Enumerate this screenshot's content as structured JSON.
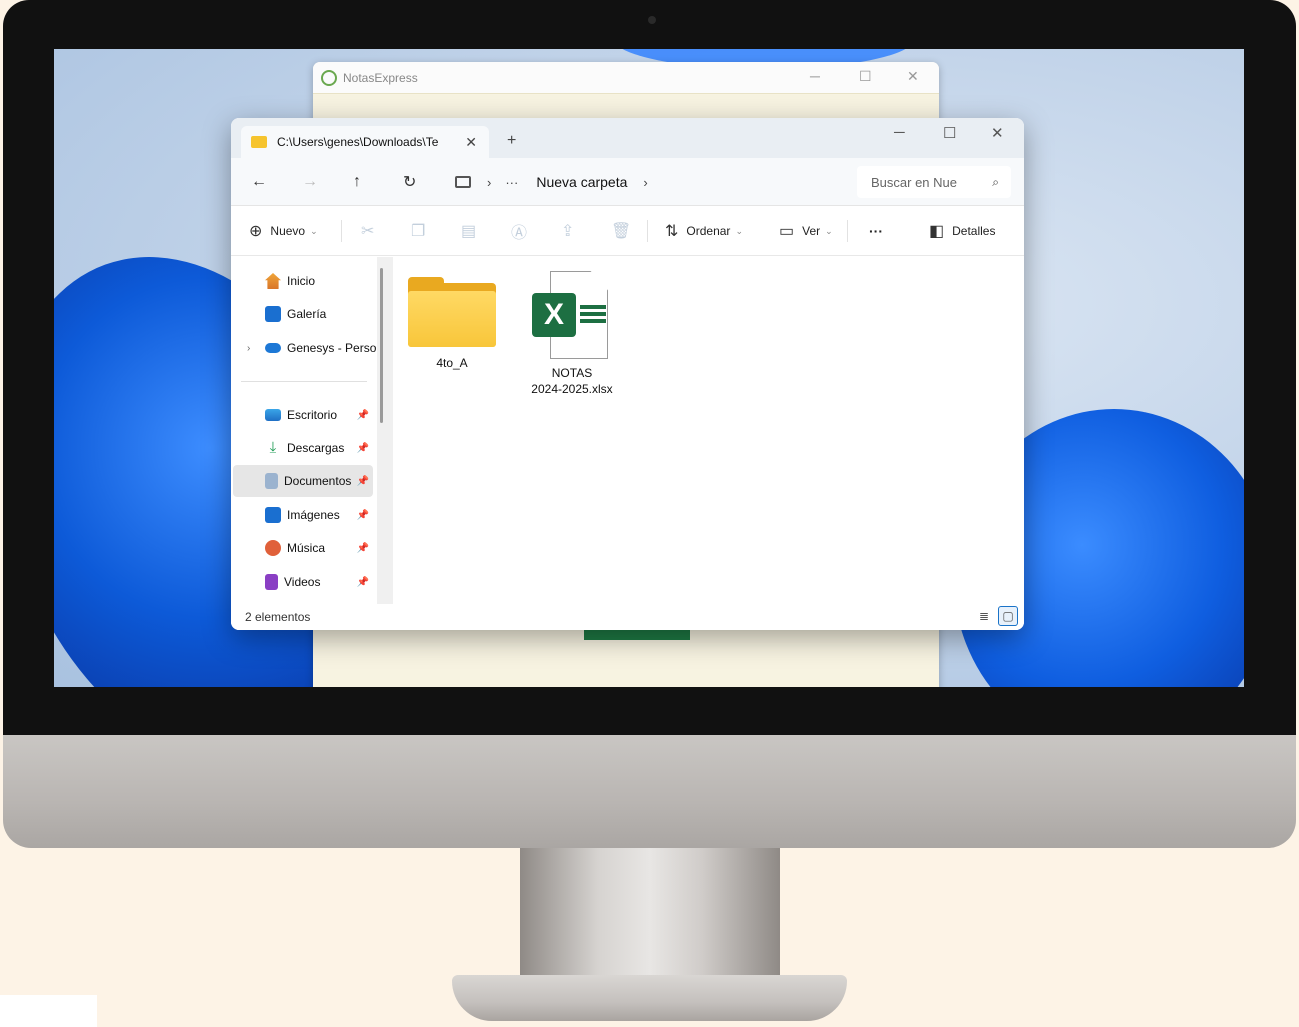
{
  "notas_window": {
    "title": "NotasExpress"
  },
  "explorer": {
    "tab_title": "C:\\Users\\genes\\Downloads\\Te",
    "new_tab": "+",
    "breadcrumb": {
      "dots": "···",
      "current": "Nueva carpeta"
    },
    "search": {
      "placeholder": "Buscar en Nue"
    },
    "toolbar": {
      "new_label": "Nuevo",
      "sort_label": "Ordenar",
      "view_label": "Ver",
      "more_label": "···",
      "details_label": "Detalles"
    },
    "sidebar": {
      "items": [
        {
          "label": "Inicio",
          "icon": "home-icon"
        },
        {
          "label": "Galería",
          "icon": "gallery-icon"
        },
        {
          "label": "Genesys - Persor",
          "icon": "onedrive-icon"
        },
        {
          "label": "Escritorio",
          "icon": "desktop-icon"
        },
        {
          "label": "Descargas",
          "icon": "downloads-icon"
        },
        {
          "label": "Documentos",
          "icon": "documents-icon",
          "selected": true
        },
        {
          "label": "Imágenes",
          "icon": "pictures-icon"
        },
        {
          "label": "Música",
          "icon": "music-icon"
        },
        {
          "label": "Videos",
          "icon": "videos-icon"
        }
      ]
    },
    "files": [
      {
        "name": "4to_A",
        "type": "folder"
      },
      {
        "name_line1": "NOTAS",
        "name_line2": "2024-2025.xlsx",
        "type": "excel"
      }
    ],
    "status": "2 elementos"
  }
}
